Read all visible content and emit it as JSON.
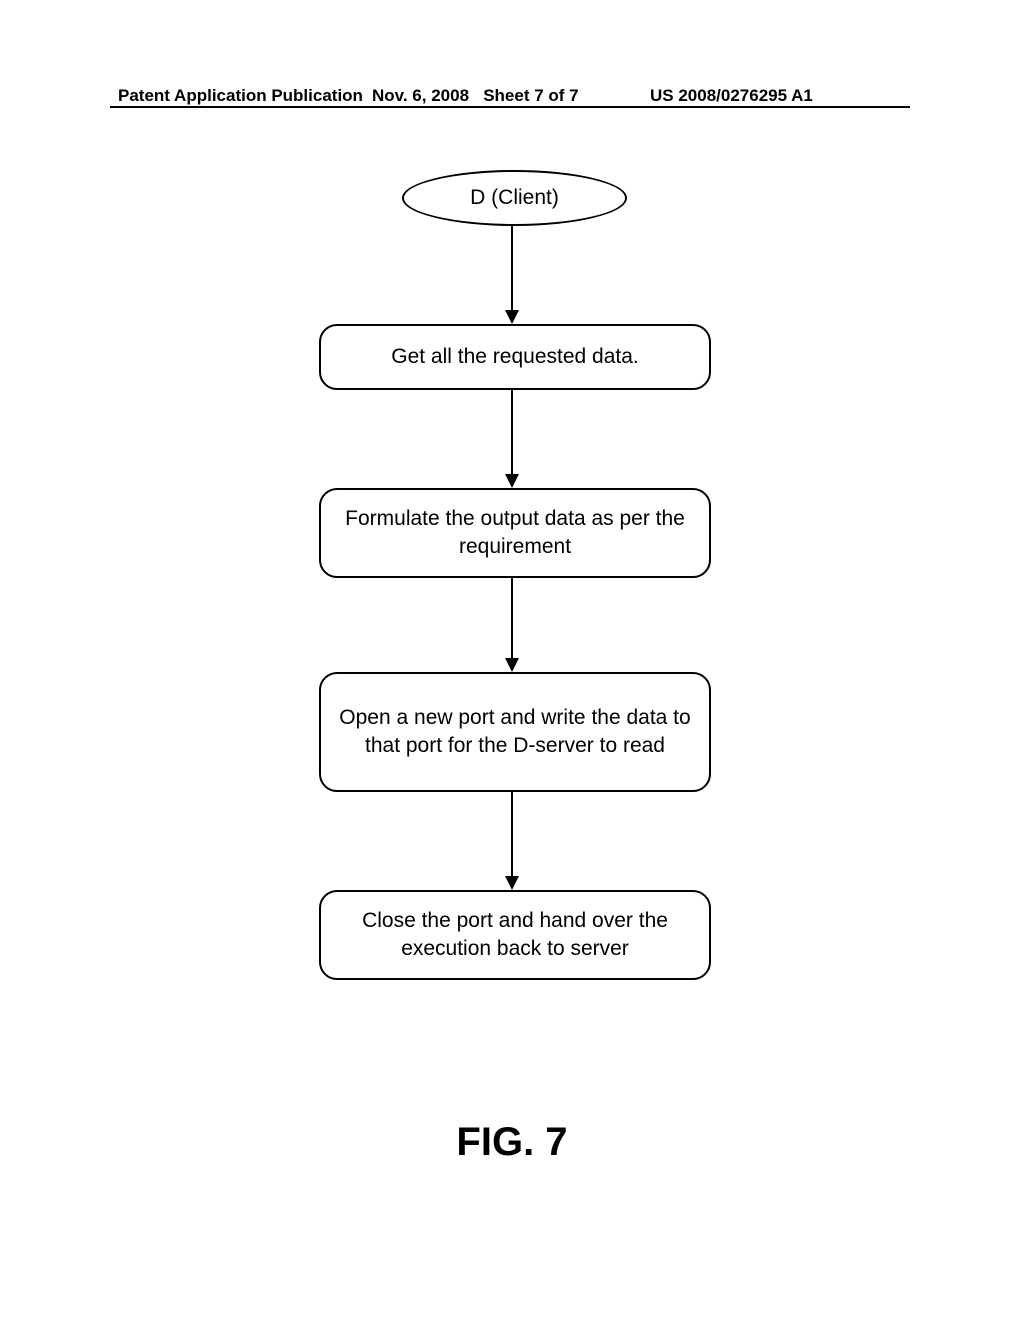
{
  "header": {
    "left": "Patent Application Publication",
    "mid_date": "Nov. 6, 2008",
    "mid_sheet": "Sheet 7 of 7",
    "right": "US 2008/0276295 A1"
  },
  "flowchart": {
    "start": "D (Client)",
    "steps": [
      "Get all the requested data.",
      "Formulate the output data as per the requirement",
      "Open a new port and write the data to that port for the D-server to read",
      "Close the port and hand over the execution back to server"
    ]
  },
  "figure_label": "FIG. 7"
}
